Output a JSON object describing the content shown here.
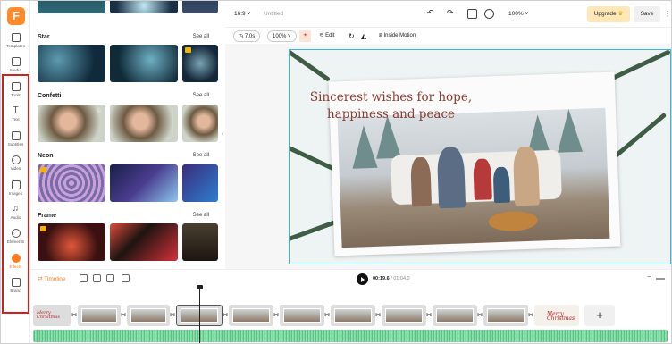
{
  "app": {
    "logo": "F"
  },
  "rail": {
    "items": [
      {
        "label": "Templates",
        "icon": "templates-icon"
      },
      {
        "label": "Media",
        "icon": "media-icon"
      },
      {
        "label": "Tools",
        "icon": "tools-icon"
      },
      {
        "label": "Text",
        "icon": "text-icon"
      },
      {
        "label": "Subtitles",
        "icon": "subtitles-icon"
      },
      {
        "label": "Video",
        "icon": "video-icon"
      },
      {
        "label": "Images",
        "icon": "images-icon"
      },
      {
        "label": "Audio",
        "icon": "audio-icon"
      },
      {
        "label": "Elements",
        "icon": "elements-icon"
      },
      {
        "label": "Effects",
        "icon": "effects-icon",
        "active": true
      },
      {
        "label": "Brand",
        "icon": "brand-icon"
      }
    ]
  },
  "effects": {
    "sections": [
      {
        "title": "Star",
        "see_all": "See all"
      },
      {
        "title": "Confetti",
        "see_all": "See all"
      },
      {
        "title": "Neon",
        "see_all": "See all"
      },
      {
        "title": "Frame",
        "see_all": "See all"
      }
    ]
  },
  "topbar": {
    "ratio": "16:9",
    "project_title": "Untitled",
    "zoom": "100%",
    "upgrade": "Upgrade",
    "save": "Save"
  },
  "toolbar": {
    "duration": "7.0s",
    "scale": "100%",
    "edit": "Edit",
    "inside_motion": "Inside Motion"
  },
  "canvas": {
    "headline_line1": "Sincerest wishes for hope,",
    "headline_line2": "happiness and peace"
  },
  "timeline": {
    "label": "Timeline",
    "current_time": "00:19.6",
    "total_time": "/ 01:04.0",
    "clip_text": "Merry Christmas"
  },
  "colors": {
    "accent": "#ff7a1a",
    "selection": "#33b9d6",
    "highlight_box": "#d0201e",
    "audio": "#6ccf94"
  }
}
